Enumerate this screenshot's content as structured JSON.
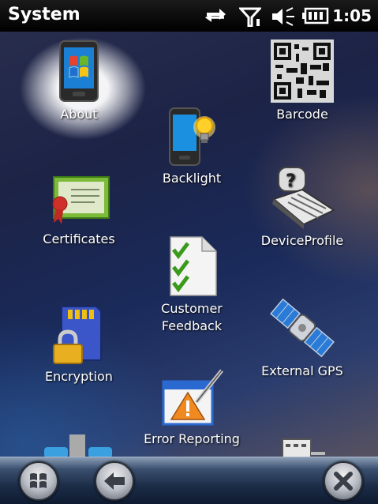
{
  "status_bar": {
    "title": "System",
    "time": "1:05"
  },
  "tiles": [
    {
      "label": "About",
      "icon": "phone-windows-icon"
    },
    {
      "label": "Barcode",
      "icon": "qr-code-icon"
    },
    {
      "label": "Backlight",
      "icon": "phone-bulb-icon"
    },
    {
      "label": "Certificates",
      "icon": "certificate-icon"
    },
    {
      "label": "DeviceProfile",
      "icon": "device-profile-icon"
    },
    {
      "label": "Customer\nFeedback",
      "icon": "checklist-icon"
    },
    {
      "label": "Encryption",
      "icon": "sd-card-lock-icon"
    },
    {
      "label": "External GPS",
      "icon": "satellite-icon"
    },
    {
      "label": "Error Reporting",
      "icon": "error-report-icon"
    }
  ],
  "bottom_bar": {
    "start": "windows-start-icon",
    "back": "back-arrow-icon",
    "close": "close-icon"
  }
}
